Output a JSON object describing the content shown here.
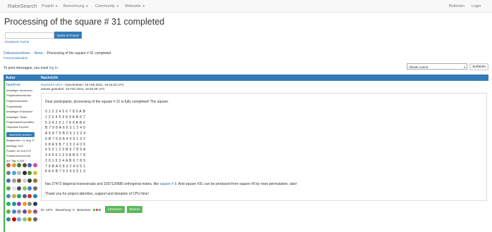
{
  "navbar": {
    "brand": "RakeSearch",
    "items": [
      "Projekt",
      "Berechnung",
      "Community",
      "Webseite"
    ],
    "right": [
      "Beitreten",
      "Login"
    ]
  },
  "page": {
    "title": "Processing of the square # 31 completed"
  },
  "search": {
    "button": "Suche im Forum",
    "advanced": "Erweiterte Suche"
  },
  "breadcrumb": {
    "forums": "Diskussionsforen",
    "news": "News",
    "current": "Processing of the square # 31 completed"
  },
  "forum_moderation": "Forenmoderation",
  "login_note": {
    "prefix": "To post messages, you must",
    "link": "log in",
    "suffix": "."
  },
  "sort": {
    "selected": "Älteste zuerst",
    "button": "Sortieren"
  },
  "table": {
    "col_author": "Autor",
    "col_post": "Nachricht"
  },
  "author": {
    "name": "hoarfrost",
    "roles": [
      "freiwilliger Moderator",
      "Projektadministrator",
      "Projektentwickler",
      "Projekttester",
      "freiwilliger Entwickler",
      "freiwilliger Tester",
      "Projektwissenschaftler",
      "Helpdesk Experte"
    ],
    "pm_button": "Nachricht senden",
    "stats": [
      "Beigetreten: 11 Aug 17",
      "Beiträge: 620",
      "Punkte: 20,315,075",
      "Punktedurchschnitt",
      "pro Tag: 6,204"
    ],
    "badge_colors": [
      "#d9534f",
      "#e0a02b",
      "#3c7d3c",
      "#6b4b2a",
      "#3a66b0",
      "#c94fb1",
      "#7b7b7b",
      "#4aa3d8",
      "#b8b8b8",
      "#2e2e2e",
      "#5a8f2e",
      "#d1c036",
      "#4c6fa5",
      "#9a9a9a",
      "#7c5a2f",
      "#cfcfcf",
      "#3a3a3a",
      "#a36b2e",
      "#5aa65a",
      "#e0e0e0",
      "#444466",
      "#8cc152",
      "#3b7dd8",
      "#6b6b6b",
      "#4b8bbe",
      "#d3a847",
      "#2f9e63",
      "#5b5b9a",
      "#c0392b",
      "#2980b9",
      "#27ae60",
      "#16a085",
      "#8e44ad",
      "#f39c12",
      "#7f8c8d",
      "#2c3e50",
      "#6aa84f",
      "#3d85c6",
      "#999999",
      "#674ea7",
      "#e69138",
      "#a64d79",
      "#45818e",
      "#cc0000",
      "#6fa8dc",
      "#93c47d",
      "#bf9000",
      "#666666"
    ]
  },
  "post": {
    "meta_link": "Nachricht 1871",
    "meta_text": " - Geschrieben: 15 Feb 2024, 19:16:33 UTC",
    "edited": "Zuletzt geändert: 15 Feb 2024, 19:25:38 UTC",
    "greeting": "Dear participants, processing of the square # 31 is fully completed! The square:",
    "square": [
      "0 1 2 3 4 5 6 7 8 9 A B",
      "1 2 0 4 5 3 8 9 A B 6 7",
      "5 3 4 2 0 1 7 8 9 A B 6",
      "B 7 9 8 A 6 5 3 1 2 4 0",
      "A 6 8 7 9 B 0 5 1 3 2 4",
      "9 B 7 6 8 A 4 0 5 1 3 2",
      "6 8 A 9 B 7 1 3 2 4 0 5",
      "4 5 3 1 2 0 B 6 7 8 9 A",
      "3 4 5 0 1 2 9 A B 6 7 8",
      "2 0 1 5 3 4 A B 6 7 8 9",
      "7 9 B A 6 8 3 2 4 0 5 1",
      "8 A 6 B 7 9 2 4 0 5 1 3"
    ],
    "text1_prefix": "has 27472 diagonal transversals and 1037120685 orthogonal mates, like ",
    "text1_link": "square # 9",
    "text1_suffix": ". And square #31 can be produced from square #9 by rows permutation, also!",
    "text2": "Thank you for project attention, support and donation of CPU time!"
  },
  "footer": {
    "id_text": "ID: 1871 · Bewertung: 0 · Bewerten: ",
    "reply": "Antworten",
    "quote": "Zitieren"
  }
}
